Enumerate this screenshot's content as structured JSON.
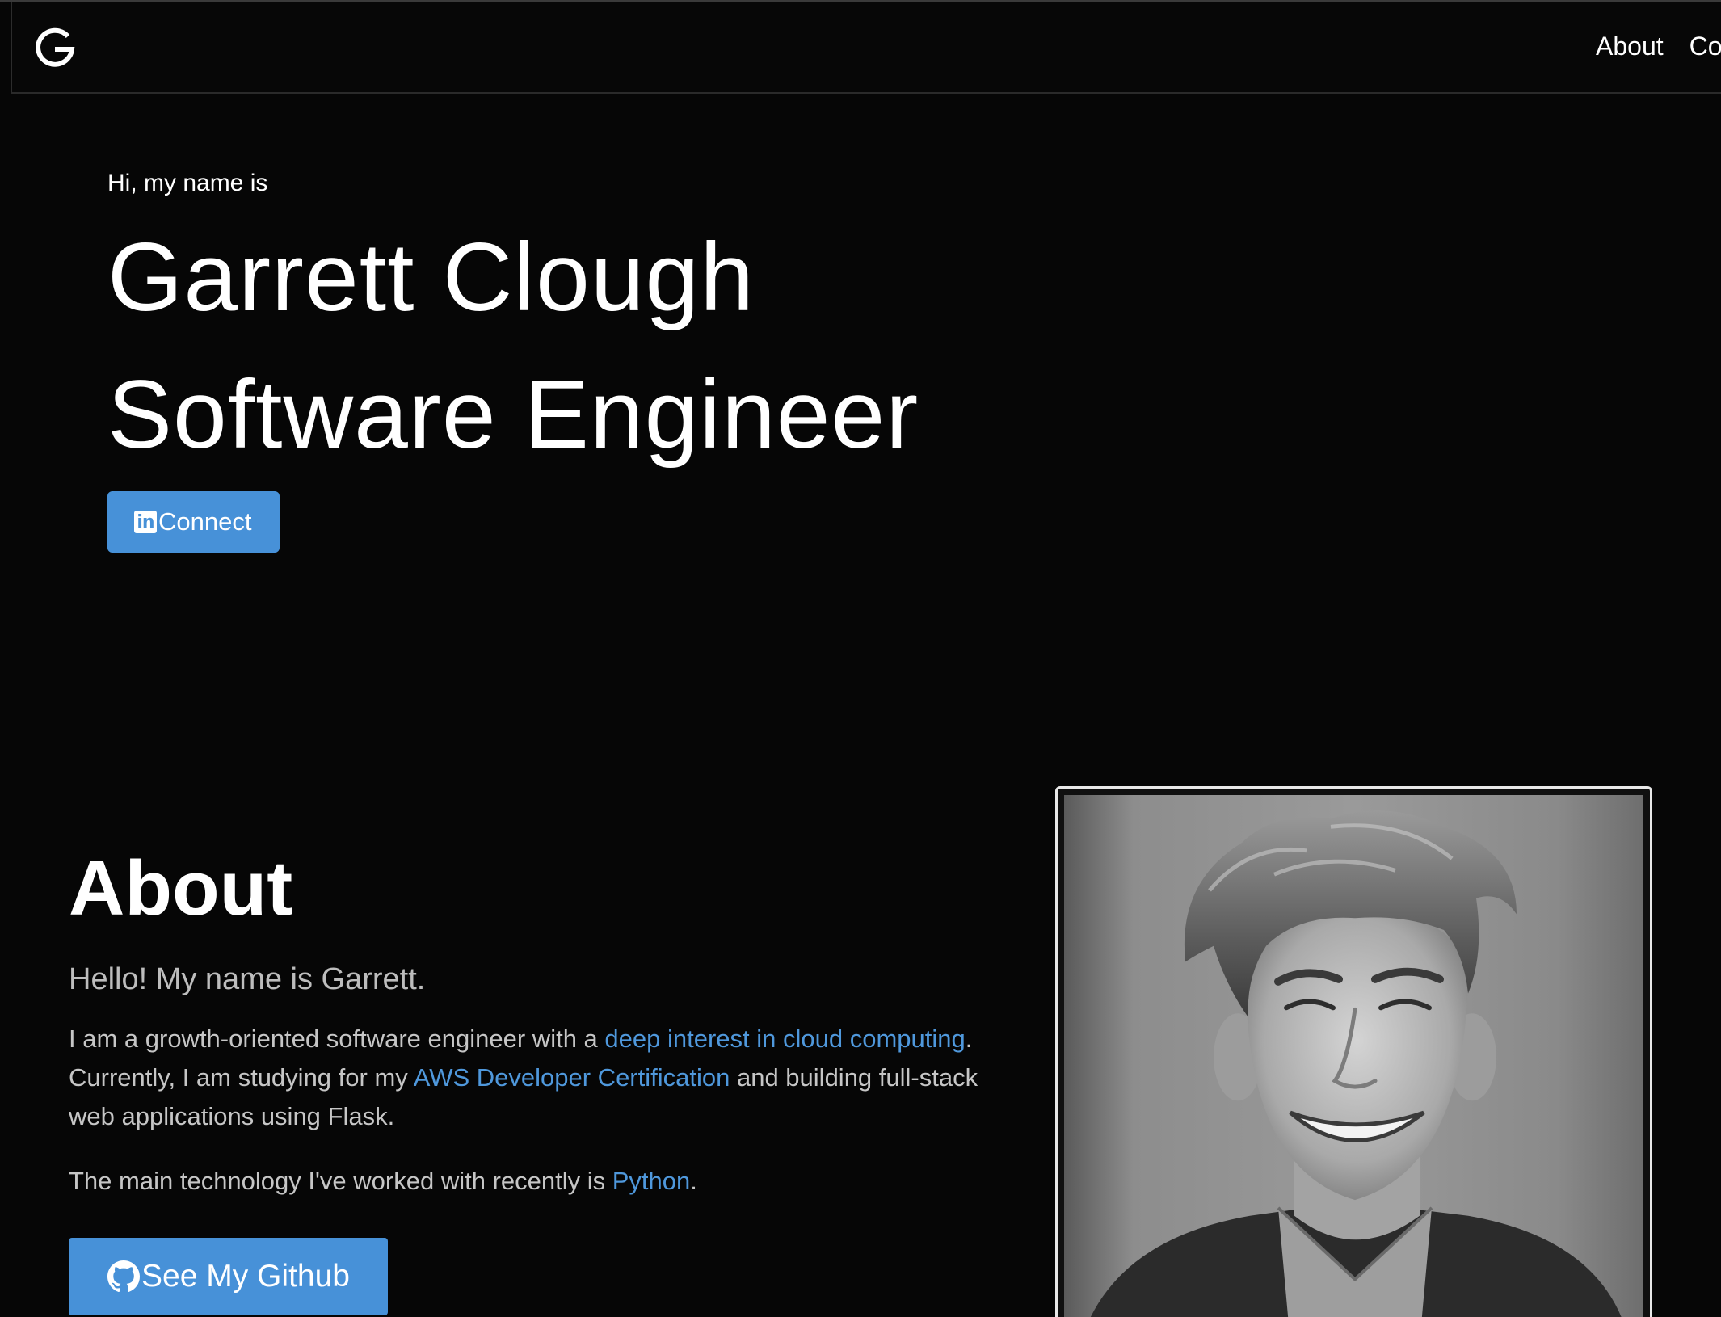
{
  "nav": {
    "logo_letter": "G",
    "links": [
      "About",
      "Co"
    ]
  },
  "hero": {
    "intro": "Hi, my name is",
    "name": "Garrett Clough",
    "role": "Software Engineer",
    "connect_icon": "in",
    "connect_label": "Connect"
  },
  "about": {
    "heading": "About",
    "greeting": "Hello! My name is Garrett.",
    "p1_text_a": "I am a growth-oriented software engineer with a ",
    "p1_link_a": "deep interest in cloud computing",
    "p1_text_b": ". Currently, I am studying for my ",
    "p1_link_b": "AWS Developer Certification",
    "p1_text_c": " and building full-stack web applications using Flask.",
    "p2_text_a": "The main technology I've worked with recently is ",
    "p2_link": "Python",
    "p2_text_b": ".",
    "github_label": "See My Github"
  },
  "colors": {
    "background": "#060606",
    "accent": "#4791d8",
    "link": "#4f98dc"
  },
  "icons": [
    "g-logo-icon",
    "linkedin-icon",
    "github-icon"
  ]
}
